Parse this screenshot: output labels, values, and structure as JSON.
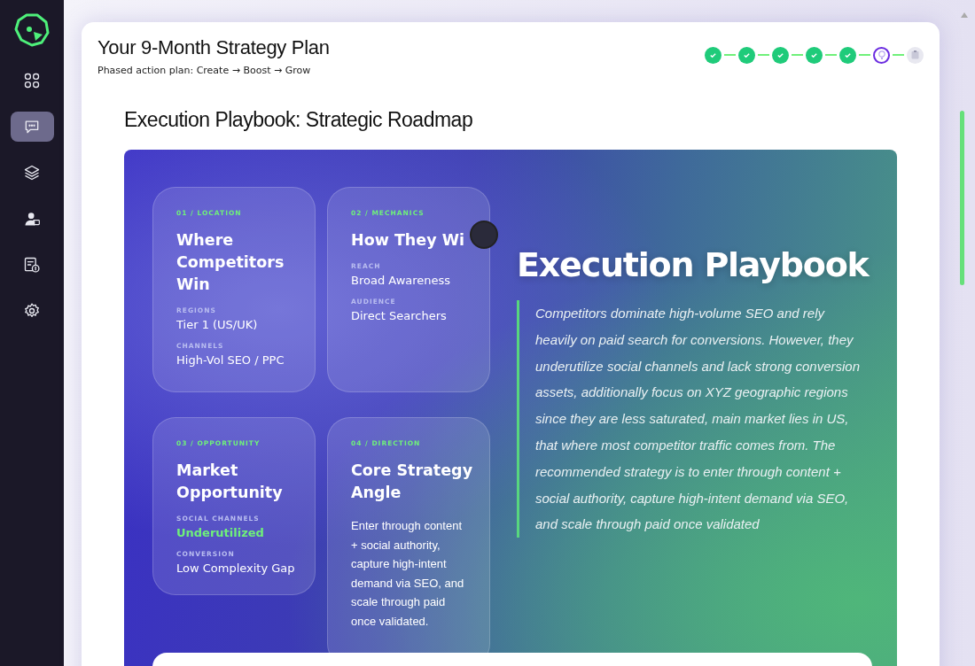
{
  "sidebar": {
    "items": [
      {
        "selected": false
      },
      {
        "selected": true
      },
      {
        "selected": false
      },
      {
        "selected": false
      },
      {
        "selected": false
      },
      {
        "selected": false
      }
    ]
  },
  "header": {
    "title": "Your 9-Month Strategy Plan",
    "subtitle": "Phased action plan: Create → Boost → Grow"
  },
  "steps": [
    {
      "kind": "done"
    },
    {
      "kind": "done"
    },
    {
      "kind": "done"
    },
    {
      "kind": "done"
    },
    {
      "kind": "done"
    },
    {
      "kind": "current"
    },
    {
      "kind": "pending"
    }
  ],
  "section_title": "Execution Playbook: Strategic Roadmap",
  "cards": [
    {
      "tag": "01 / LOCATION",
      "title": "Where Competitors Win",
      "fields": [
        {
          "label": "REGIONS",
          "value": "Tier 1 (US/UK)",
          "highlight": false
        },
        {
          "label": "CHANNELS",
          "value": "High-Vol SEO / PPC",
          "highlight": false
        }
      ]
    },
    {
      "tag": "02 / MECHANICS",
      "title": "How They Wi",
      "fields": [
        {
          "label": "REACH",
          "value": "Broad Awareness",
          "highlight": false
        },
        {
          "label": "AUDIENCE",
          "value": "Direct Searchers",
          "highlight": false
        }
      ]
    },
    {
      "tag": "03 / OPPORTUNITY",
      "title": "Market Opportunity",
      "fields": [
        {
          "label": "SOCIAL CHANNELS",
          "value": "Underutilized",
          "highlight": true
        },
        {
          "label": "CONVERSION",
          "value": "Low Complexity Gap",
          "highlight": false
        }
      ]
    },
    {
      "tag": "04 / DIRECTION",
      "title": "Core Strategy Angle",
      "body": "Enter through content + social authority, capture high-intent demand via SEO, and scale through paid once validated."
    }
  ],
  "playbook": {
    "title": "Execution Playbook",
    "summary": "Competitors dominate high-volume SEO and rely heavily on paid search for conversions. However, they underutilize social channels and lack strong conversion assets, additionally focus on XYZ geographic regions since they are less saturated, main market lies in US, that where most competitor traffic comes from. The recommended strategy is to enter through content + social authority, capture high-intent demand via SEO, and scale through paid once validated"
  }
}
